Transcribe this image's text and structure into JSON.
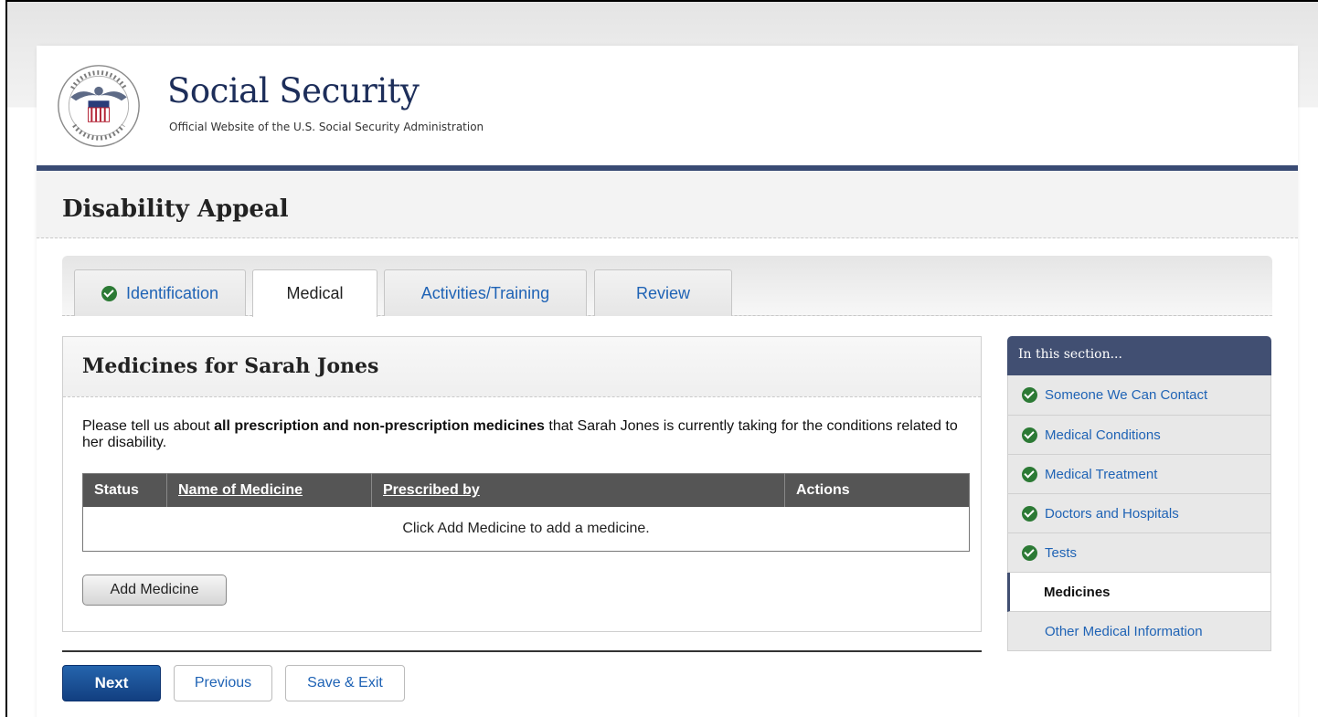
{
  "header": {
    "brand_title": "Social Security",
    "brand_subtitle": "Official Website of the U.S. Social Security Administration",
    "seal_icon": "ssa-seal-icon",
    "navy_color": "#394b74"
  },
  "page_title": "Disability Appeal",
  "tabs": [
    {
      "label": "Identification",
      "completed": true
    },
    {
      "label": "Medical",
      "active": true
    },
    {
      "label": "Activities/Training"
    },
    {
      "label": "Review"
    }
  ],
  "main": {
    "panel_title": "Medicines for Sarah Jones",
    "intro_before": "Please tell us about ",
    "intro_bold": "all prescription and non-prescription medicines",
    "intro_after": " that Sarah Jones is currently taking for the conditions related to her disability.",
    "table": {
      "headers": [
        "Status",
        "Name of Medicine",
        "Prescribed by",
        "Actions"
      ],
      "empty_message": "Click Add Medicine to add a medicine."
    },
    "add_button": "Add Medicine"
  },
  "nav_buttons": {
    "next": "Next",
    "previous": "Previous",
    "save_exit": "Save & Exit"
  },
  "sidebar": {
    "heading": "In this section...",
    "items": [
      {
        "label": "Someone We Can Contact",
        "completed": true
      },
      {
        "label": "Medical Conditions",
        "completed": true
      },
      {
        "label": "Medical Treatment",
        "completed": true
      },
      {
        "label": "Doctors and Hospitals",
        "completed": true
      },
      {
        "label": "Tests",
        "completed": true
      },
      {
        "label": "Medicines",
        "current": true
      },
      {
        "label": "Other Medical Information"
      }
    ]
  },
  "colors": {
    "link": "#1f63b5",
    "check": "#2c7a35",
    "next_button": "#1a4f93",
    "sidebar_header": "#414f72"
  }
}
